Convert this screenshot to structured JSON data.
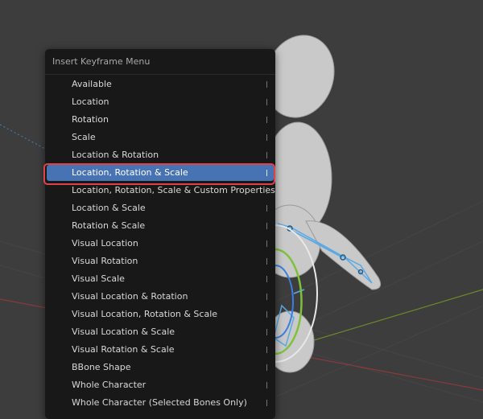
{
  "menu": {
    "title": "Insert Keyframe Menu",
    "items": [
      {
        "label": "Available"
      },
      {
        "label": "Location"
      },
      {
        "label": "Rotation"
      },
      {
        "label": "Scale"
      },
      {
        "label": "Location & Rotation"
      },
      {
        "label": "Location, Rotation & Scale",
        "active": true
      },
      {
        "label": "Location, Rotation, Scale & Custom Properties"
      },
      {
        "label": "Location & Scale"
      },
      {
        "label": "Rotation & Scale"
      },
      {
        "label": "Visual Location"
      },
      {
        "label": "Visual Rotation"
      },
      {
        "label": "Visual Scale"
      },
      {
        "label": "Visual Location & Rotation"
      },
      {
        "label": "Visual Location, Rotation & Scale"
      },
      {
        "label": "Visual Location & Scale"
      },
      {
        "label": "Visual Rotation & Scale"
      },
      {
        "label": "BBone Shape"
      },
      {
        "label": "Whole Character"
      },
      {
        "label": "Whole Character (Selected Bones Only)"
      }
    ]
  },
  "colors": {
    "menu_bg": "#181818",
    "active_item": "#4772b3",
    "highlight_outline": "#e0424a",
    "viewport_bg": "#3d3d3d",
    "armature": "#5aa9e6",
    "x_axis": "#8a3a3a",
    "y_axis": "#6a8a2a"
  }
}
